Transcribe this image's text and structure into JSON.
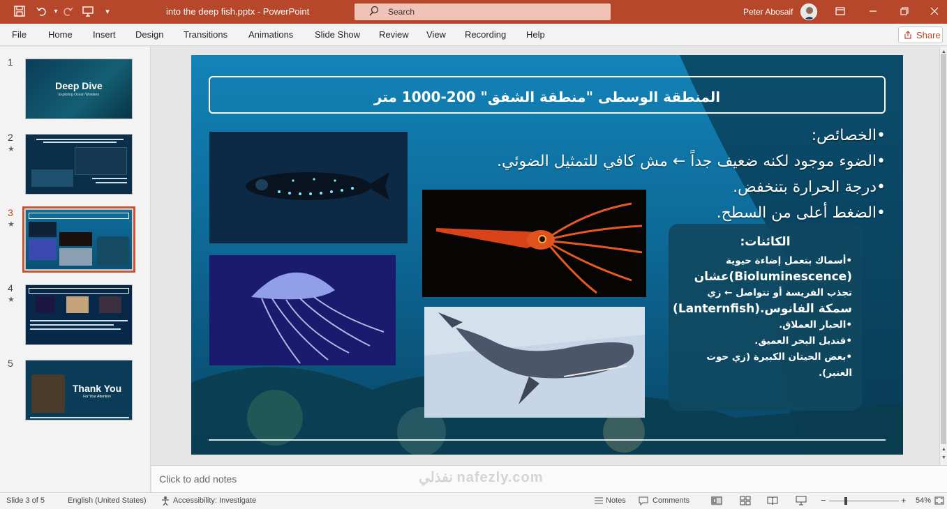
{
  "titlebar": {
    "document_title": "into the deep fish.pptx  -  PowerPoint",
    "search_placeholder": "Search",
    "user_name": "Peter Abosaif",
    "accent_color": "#b7472a"
  },
  "ribbon": {
    "tabs": [
      "File",
      "Home",
      "Insert",
      "Design",
      "Transitions",
      "Animations",
      "Slide Show",
      "Review",
      "View",
      "Recording",
      "Help"
    ],
    "share_label": "Share"
  },
  "thumbnails": [
    {
      "number": "1",
      "title": "Deep Dive",
      "subtitle": "Exploring Ocean Wonders",
      "has_animation": false,
      "active": false
    },
    {
      "number": "2",
      "title": "",
      "subtitle": "",
      "has_animation": true,
      "active": false
    },
    {
      "number": "3",
      "title": "",
      "subtitle": "",
      "has_animation": true,
      "active": true
    },
    {
      "number": "4",
      "title": "",
      "subtitle": "",
      "has_animation": true,
      "active": false
    },
    {
      "number": "5",
      "title": "Thank You",
      "subtitle": "For Your Attention",
      "has_animation": false,
      "active": false
    }
  ],
  "slide": {
    "title": "المنطقة الوسطى \"منطقة الشفق\" 200-1000 متر",
    "bullets": [
      "•الخصائص:",
      "•الضوء موجود لكنه ضعيف جداً ← مش كافي للتمثيل الضوئي.",
      "•درجة الحرارة بتنخفض.",
      "•الضغط أعلى من السطح."
    ],
    "infobox": {
      "title": "الكائنات:",
      "lines": [
        "•أسماك بتعمل إضاءة حيوية",
        "(Bioluminescence)عشان",
        "تجذب الفريسة أو تتواصل ← زي",
        "سمكة الفانوس.(Lanternfish)",
        "•الحبار العملاق.",
        "•قنديل البحر العميق.",
        "•بعض الحيتان الكبيرة (زي حوت",
        "العنبر)."
      ]
    }
  },
  "notes": {
    "placeholder": "Click to add notes",
    "watermark": "نفذلي nafezly.com"
  },
  "statusbar": {
    "slide_info": "Slide 3 of 5",
    "language": "English (United States)",
    "accessibility": "Accessibility: Investigate",
    "notes_label": "Notes",
    "comments_label": "Comments",
    "zoom_percent": "54%",
    "zoom_level": 54,
    "minus": "−",
    "plus": "+"
  }
}
